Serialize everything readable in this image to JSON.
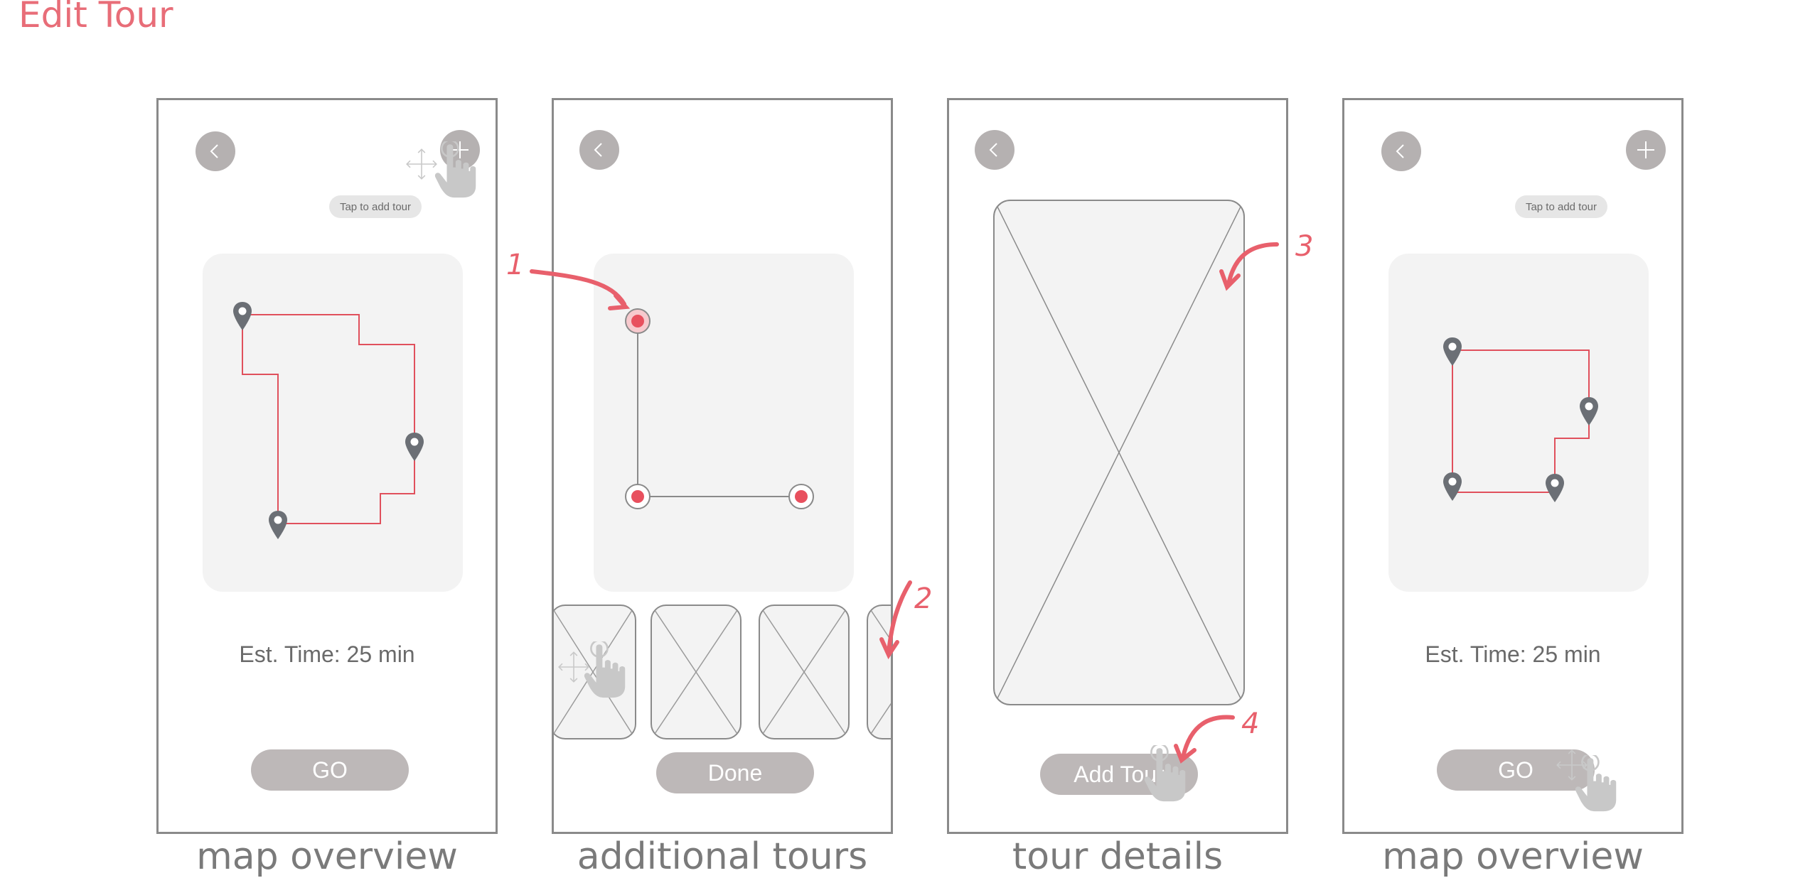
{
  "title": "Edit Tour",
  "colors": {
    "accent": "#e86d78",
    "route": "#e0505c",
    "pin": "#6b6f75",
    "button": "#bdb8b8",
    "card": "#f3f3f3"
  },
  "screens": [
    {
      "caption": "map overview",
      "tooltip": "Tap to add tour",
      "est_time": "Est. Time: 25 min",
      "button": "GO",
      "icons": [
        "back-icon",
        "plus-icon",
        "move-icon",
        "tap-hand-icon",
        "map-pin-icon"
      ]
    },
    {
      "caption": "additional tours",
      "button": "Done",
      "icons": [
        "back-icon",
        "move-icon",
        "tap-hand-icon",
        "image-placeholder-icon"
      ]
    },
    {
      "caption": "tour details",
      "button": "Add Tour",
      "icons": [
        "back-icon",
        "image-placeholder-icon",
        "tap-hand-icon"
      ]
    },
    {
      "caption": "map overview",
      "tooltip": "Tap to add tour",
      "est_time": "Est. Time: 25 min",
      "button": "GO",
      "icons": [
        "back-icon",
        "plus-icon",
        "map-pin-icon",
        "move-icon",
        "tap-hand-icon"
      ]
    }
  ],
  "annotations": [
    "1",
    "2",
    "3",
    "4"
  ]
}
